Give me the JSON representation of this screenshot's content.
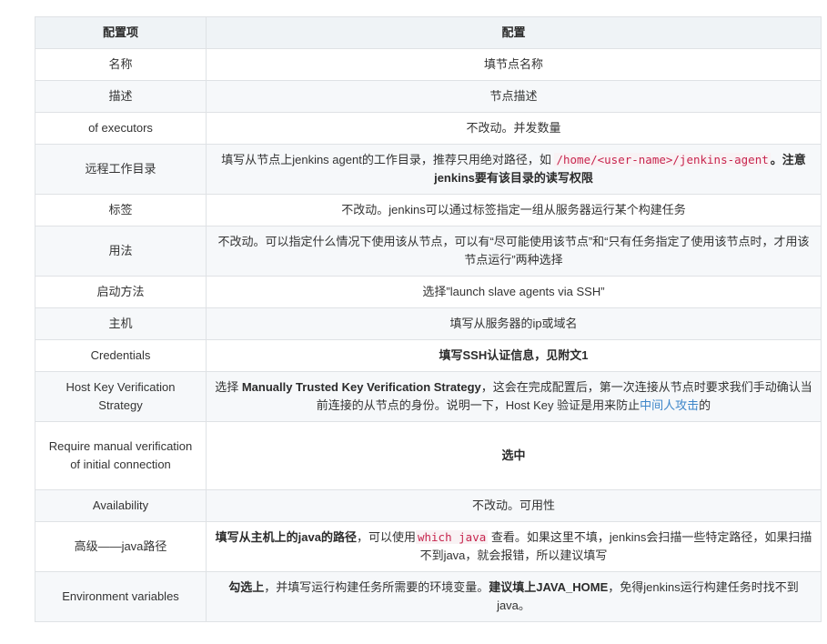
{
  "headers": {
    "item": "配置项",
    "config": "配置"
  },
  "rows": [
    {
      "item": "名称",
      "config": "填节点名称"
    },
    {
      "item": "描述",
      "config": "节点描述"
    },
    {
      "item": "of executors",
      "config": "不改动。并发数量"
    },
    {
      "item": "远程工作目录",
      "pre": "填写从节点上jenkins agent的工作目录，推荐只用绝对路径，如",
      "code": "/home/<user-name>/jenkins-agent",
      "bold": "。注意jenkins要有该目录的读写权限"
    },
    {
      "item": "标签",
      "config": "不改动。jenkins可以通过标签指定一组从服务器运行某个构建任务"
    },
    {
      "item": "用法",
      "config": "不改动。可以指定什么情况下使用该从节点，可以有“尽可能使用该节点”和“只有任务指定了使用该节点时，才用该节点运行”两种选择"
    },
    {
      "item": "启动方法",
      "config": "选择”launch slave agents via SSH”"
    },
    {
      "item": "主机",
      "config": "填写从服务器的ip或域名"
    },
    {
      "item": "Credentials",
      "bold": "填写SSH认证信息，见附文1"
    },
    {
      "item": "Host Key Verification Strategy",
      "pre": "选择 ",
      "bold": "Manually Trusted Key Verification Strategy",
      "mid": "，这会在完成配置后，第一次连接从节点时要求我们手动确认当前连接的从节点的身份。说明一下，Host Key 验证是用来防止",
      "link": "中间人攻击",
      "post": "的"
    },
    {
      "item": "Require manual verification of initial connection",
      "bold": "选中"
    },
    {
      "item": "Availability",
      "config": "不改动。可用性"
    },
    {
      "item": "高级——java路径",
      "bold": "填写从主机上的java的路径",
      "mid": "，可以使用",
      "code": "which java",
      "post": " 查看。如果这里不填，jenkins会扫描一些特定路径，如果扫描不到java，就会报错，所以建议填写"
    },
    {
      "item": "Environment variables",
      "bold": "勾选上",
      "mid": "，并填写运行构建任务所需要的环境变量。",
      "bold2": "建议填上JAVA_HOME",
      "post": "，免得jenkins运行构建任务时找不到java。"
    }
  ]
}
